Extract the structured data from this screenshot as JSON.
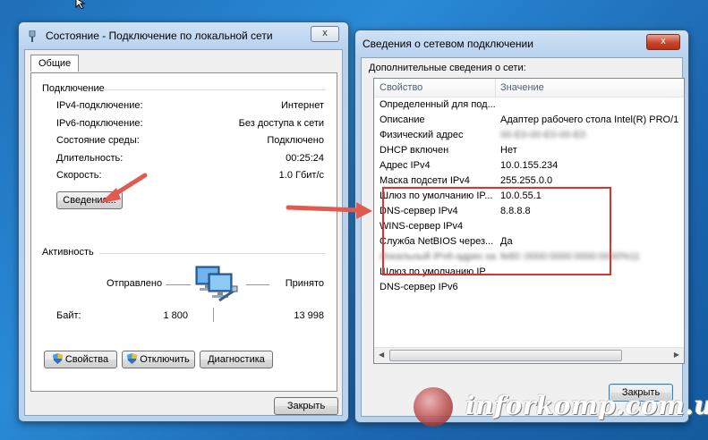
{
  "left_window": {
    "title": "Состояние - Подключение по локальной сети",
    "close": "x",
    "tab": "Общие",
    "connection_group": "Подключение",
    "rows": [
      {
        "label": "IPv4-подключение:",
        "value": "Интернет"
      },
      {
        "label": "IPv6-подключение:",
        "value": "Без доступа к сети"
      },
      {
        "label": "Состояние среды:",
        "value": "Подключено"
      },
      {
        "label": "Длительность:",
        "value": "00:25:24"
      },
      {
        "label": "Скорость:",
        "value": "1.0 Гбит/с"
      }
    ],
    "details_button": "Сведения...",
    "activity_group": "Активность",
    "sent_label": "Отправлено",
    "received_label": "Принято",
    "bytes_label": "Байт:",
    "bytes_sent": "1 800",
    "bytes_received": "13 998",
    "properties_button": "Свойства",
    "disable_button": "Отключить",
    "diagnostics_button": "Диагностика",
    "close_button": "Закрыть"
  },
  "right_window": {
    "title": "Сведения о сетевом подключении",
    "close": "x",
    "subtitle": "Дополнительные сведения о сети:",
    "col_property": "Свойство",
    "col_value": "Значение",
    "rows": [
      {
        "property": "Определенный для под...",
        "value": ""
      },
      {
        "property": "Описание",
        "value": "Адаптер рабочего стола Intel(R) PRO/1"
      },
      {
        "property": "Физический адрес",
        "value": "00-E0-00-E0-00-E0"
      },
      {
        "property": "DHCP включен",
        "value": "Нет"
      },
      {
        "property": "Адрес IPv4",
        "value": "10.0.155.234"
      },
      {
        "property": "Маска подсети IPv4",
        "value": "255.255.0.0"
      },
      {
        "property": "Шлюз по умолчанию IP...",
        "value": "10.0.55.1"
      },
      {
        "property": "DNS-сервер IPv4",
        "value": "8.8.8.8"
      },
      {
        "property": "WINS-сервер IPv4",
        "value": ""
      },
      {
        "property": "Служба NetBIOS через...",
        "value": "Да"
      },
      {
        "property": "Локальный IPv6-адрес канала",
        "value": "fe80::0000:0000:0000:0000%11"
      },
      {
        "property": "Шлюз по умолчанию IP...",
        "value": ""
      },
      {
        "property": "DNS-сервер IPv6",
        "value": ""
      }
    ],
    "close_button": "Закрыть"
  },
  "watermark": {
    "logo_text": "I.K",
    "site": "inforkomp.com.ua"
  },
  "colors": {
    "desktop": "#1f6fb8",
    "highlight_box": "#e03131",
    "arrow": "#e05a4f"
  }
}
